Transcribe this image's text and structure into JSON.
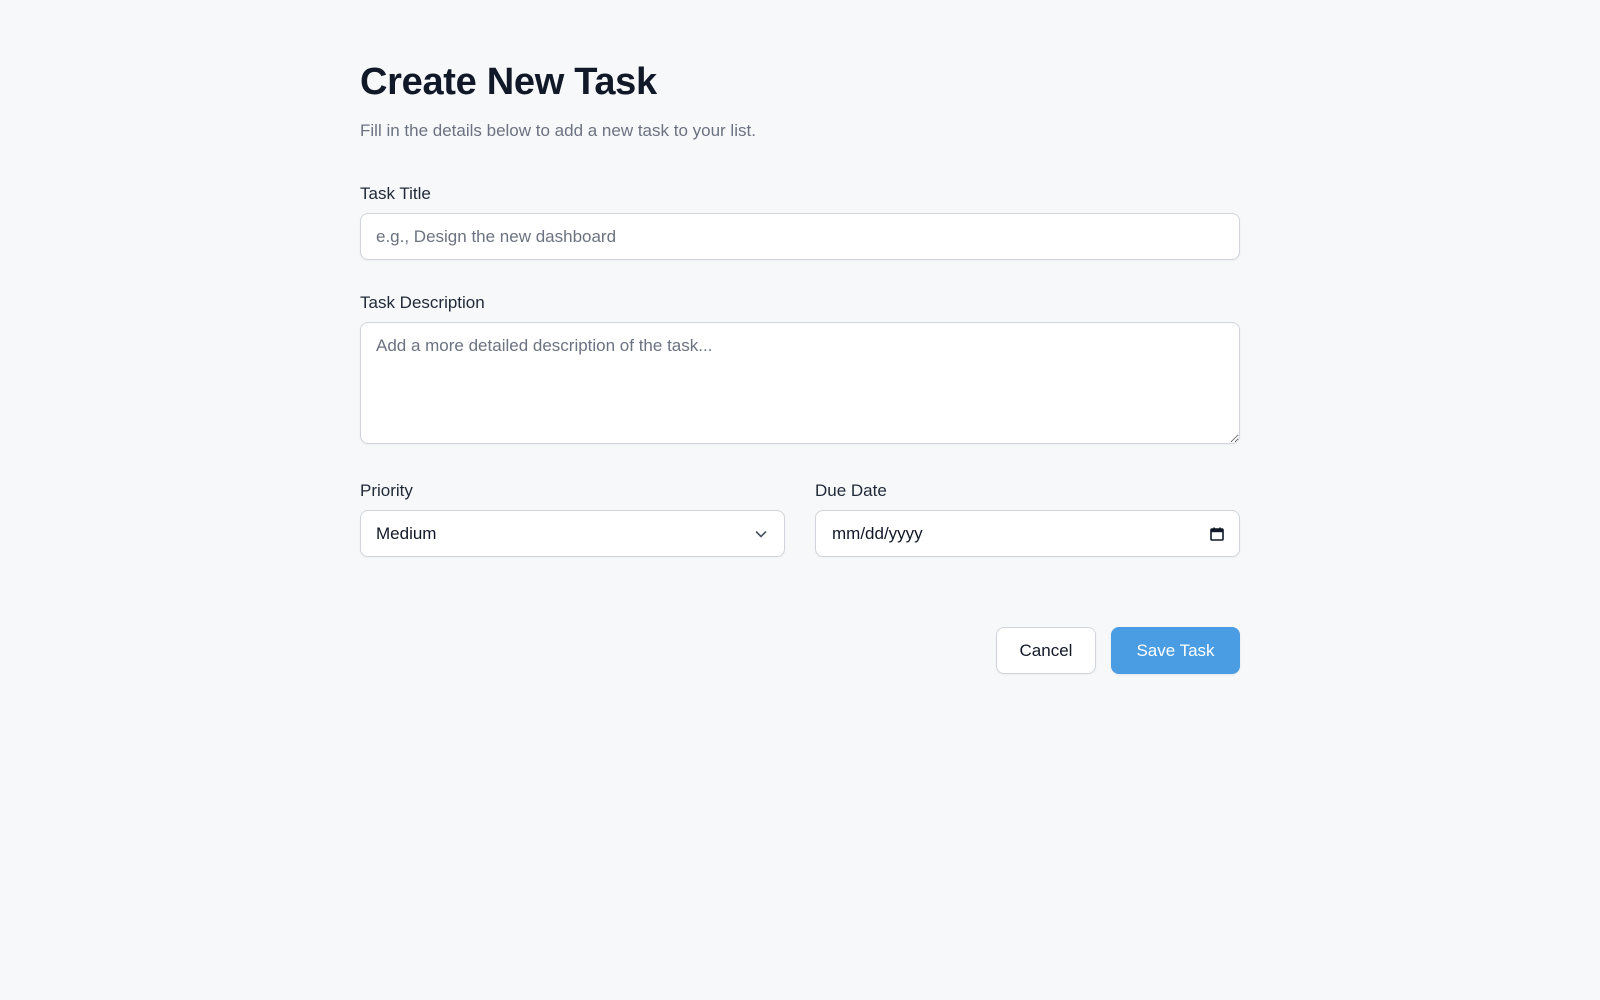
{
  "header": {
    "title": "Create New Task",
    "subtitle": "Fill in the details below to add a new task to your list."
  },
  "fields": {
    "title": {
      "label": "Task Title",
      "value": "",
      "placeholder": "e.g., Design the new dashboard"
    },
    "description": {
      "label": "Task Description",
      "value": "",
      "placeholder": "Add a more detailed description of the task..."
    },
    "priority": {
      "label": "Priority",
      "selected": "Medium",
      "icon": "chevron-down-icon"
    },
    "due_date": {
      "label": "Due Date",
      "value": "mm/dd/yyyy",
      "icon": "calendar-icon"
    }
  },
  "actions": {
    "cancel_label": "Cancel",
    "save_label": "Save Task"
  },
  "colors": {
    "background": "#f7f8fa",
    "primary": "#4a9de3",
    "border": "#d1d5db",
    "text": "#111827",
    "muted": "#6b7280"
  }
}
